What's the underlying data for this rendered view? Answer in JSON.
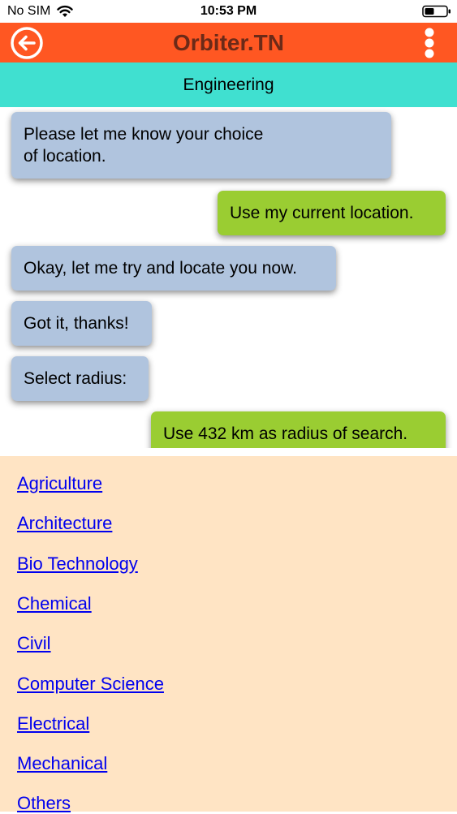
{
  "status_bar": {
    "carrier": "No SIM",
    "time": "10:53 PM",
    "wifi_icon": "wifi-icon",
    "battery_icon": "battery-icon"
  },
  "header": {
    "title": "Orbiter.TN",
    "back_icon": "back-arrow-icon",
    "menu_icon": "more-vertical-icon",
    "background_color": "#ff5722",
    "title_color": "#6b2a18"
  },
  "subheader": {
    "label": "Engineering",
    "background_color": "#40e0d0"
  },
  "chat": {
    "bot_bubble_color": "#b0c4de",
    "user_bubble_color": "#9acd32",
    "messages": [
      {
        "sender": "bot",
        "lines": [
          "Please let me know your choice",
          "of location."
        ]
      },
      {
        "sender": "user",
        "text": "Use my current location."
      },
      {
        "sender": "bot",
        "text": "Okay, let me try and locate you now."
      },
      {
        "sender": "bot",
        "text": "Got it, thanks!"
      },
      {
        "sender": "bot",
        "text": "Select radius:"
      },
      {
        "sender": "user",
        "text": "Use 432 km as radius of search."
      }
    ]
  },
  "options": {
    "background_color": "#ffe4c4",
    "items": [
      "Agriculture",
      "Architecture",
      "Bio Technology",
      "Chemical",
      "Civil",
      "Computer Science",
      "Electrical",
      "Mechanical",
      "Others"
    ]
  }
}
